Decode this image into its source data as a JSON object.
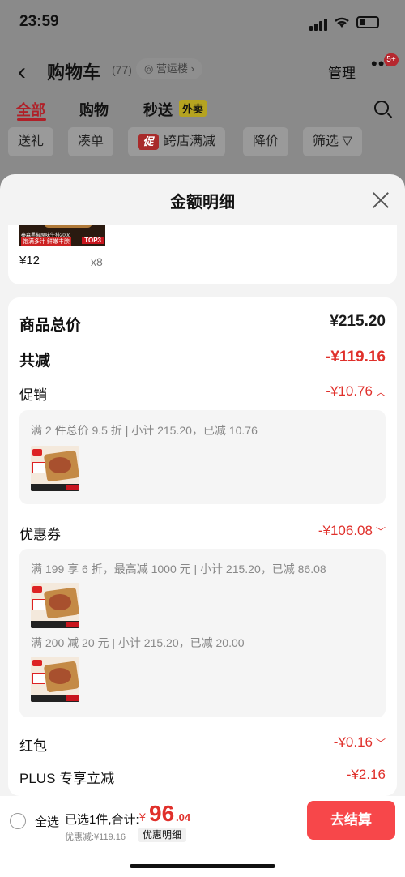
{
  "status": {
    "time": "23:59"
  },
  "nav": {
    "title": "购物车",
    "count": "(77)",
    "address": "营运楼 ›",
    "manage": "管理",
    "more": "•••",
    "badge": "5+"
  },
  "tabs": [
    {
      "label": "全部"
    },
    {
      "label": "购物"
    },
    {
      "label": "秒送"
    }
  ],
  "tab_extra": "外卖",
  "chips": [
    {
      "label": "送礼"
    },
    {
      "label": "凑单"
    },
    {
      "label": "跨店满减",
      "icon": "促"
    },
    {
      "label": "降价"
    },
    {
      "label": "筛选 ▽"
    }
  ],
  "sheet": {
    "title": "金额明细"
  },
  "product": {
    "strip_text1": "秦森黑椒原味牛排200g",
    "strip_text2": "饱满多汁  鲜嫩丰腴",
    "top_badge": "TOP3",
    "price": "¥12",
    "qty": "x8"
  },
  "summary": {
    "goods_total_label": "商品总价",
    "goods_total_value": "¥215.20",
    "total_discount_label": "共减",
    "total_discount_value": "-¥119.16",
    "promo_label": "促销",
    "promo_value": "-¥10.76",
    "promo_rule": "满 2 件总价 9.5 折 | 小计 215.20，已减 10.76",
    "coupon_label": "优惠券",
    "coupon_value": "-¥106.08",
    "coupon_rule1": "满 199 享 6 折，最高减 1000 元 | 小计 215.20，已减 86.08",
    "coupon_rule2": "满 200 减 20 元 | 小计 215.20，已减 20.00",
    "redpacket_label": "红包",
    "redpacket_value": "-¥0.16",
    "plus_label": "PLUS 专享立减",
    "plus_value": "-¥2.16"
  },
  "bottom": {
    "select_all": "全选",
    "selected_text": "已选1件,合计:",
    "currency": "¥",
    "total_int": "96",
    "total_dec": ".04",
    "discount_text": "优惠减:¥119.16",
    "detail_label": "优惠明细",
    "checkout": "去结算"
  },
  "colors": {
    "accent_red": "#e0302b",
    "checkout_bg": "#f7474a"
  }
}
